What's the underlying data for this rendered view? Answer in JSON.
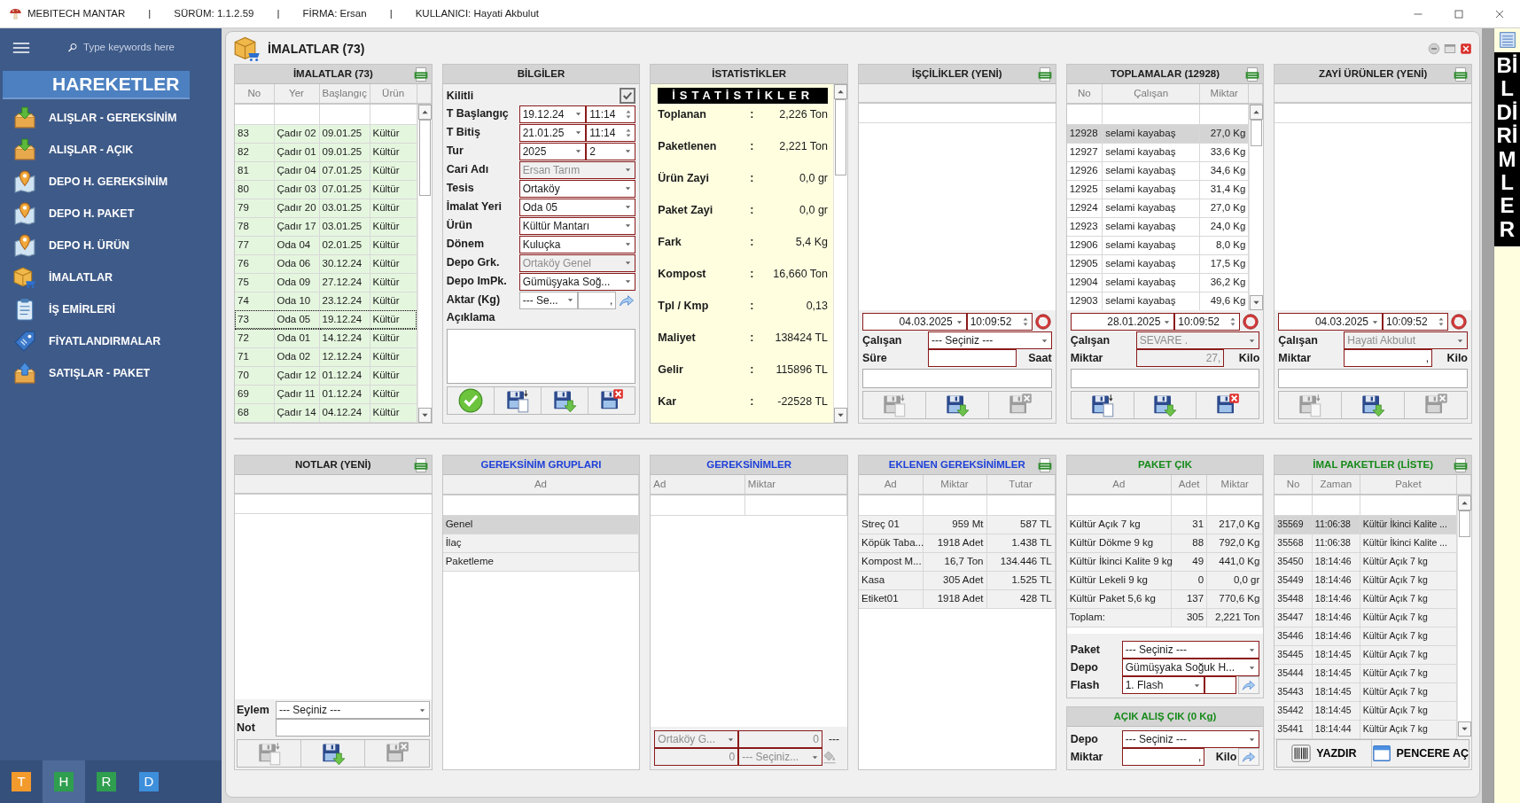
{
  "title_bar": {
    "app_name": "MEBITECH MANTAR",
    "fields": [
      {
        "sep": "|",
        "text": "SÜRÜM: 1.1.2.59"
      },
      {
        "sep": "|",
        "text": "FİRMA: Ersan"
      },
      {
        "sep": "|",
        "text": "KULLANICI: Hayati Akbulut"
      }
    ]
  },
  "sidebar": {
    "search_placeholder": "Type keywords here",
    "heading": "HAREKETLER",
    "items": [
      {
        "label": "ALIŞLAR - GEREKSİNİM",
        "kind": "tray-down"
      },
      {
        "label": "ALIŞLAR - AÇIK",
        "kind": "tray-down"
      },
      {
        "label": "DEPO H. GEREKSİNİM",
        "kind": "pin"
      },
      {
        "label": "DEPO H. PAKET",
        "kind": "pin"
      },
      {
        "label": "DEPO H. ÜRÜN",
        "kind": "pin"
      },
      {
        "label": "İMALATLAR",
        "kind": "box"
      },
      {
        "label": "İŞ EMİRLERİ",
        "kind": "clipboard"
      },
      {
        "label": "FİYATLANDIRMALAR",
        "kind": "tag"
      },
      {
        "label": "SATIŞLAR - PAKET",
        "kind": "tray-up"
      }
    ],
    "tabs": [
      {
        "label": "T",
        "color": "#f39a2c",
        "selected": false
      },
      {
        "label": "H",
        "color": "#2f9e4f",
        "selected": true
      },
      {
        "label": "R",
        "color": "#2f9e4f",
        "selected": false
      },
      {
        "label": "D",
        "color": "#3d8fdb",
        "selected": false
      }
    ]
  },
  "page_title": "İMALATLAR (73)",
  "imalatlar": {
    "title": "İMALATLAR (73)",
    "columns": [
      "No",
      "Yer",
      "Başlangıç",
      "Ürün"
    ],
    "rows": [
      {
        "cells": [
          "83",
          "Çadır 02",
          "09.01.25",
          "Kültür"
        ],
        "selected": false
      },
      {
        "cells": [
          "82",
          "Çadır 01",
          "09.01.25",
          "Kültür"
        ],
        "selected": false
      },
      {
        "cells": [
          "81",
          "Çadır 04",
          "07.01.25",
          "Kültür"
        ],
        "selected": false
      },
      {
        "cells": [
          "80",
          "Çadır 03",
          "07.01.25",
          "Kültür"
        ],
        "selected": false
      },
      {
        "cells": [
          "79",
          "Çadır 20",
          "03.01.25",
          "Kültür"
        ],
        "selected": false
      },
      {
        "cells": [
          "78",
          "Çadır 17",
          "03.01.25",
          "Kültür"
        ],
        "selected": false
      },
      {
        "cells": [
          "77",
          "Oda 04",
          "02.01.25",
          "Kültür"
        ],
        "selected": false
      },
      {
        "cells": [
          "76",
          "Oda 06",
          "30.12.24",
          "Kültür"
        ],
        "selected": false
      },
      {
        "cells": [
          "75",
          "Oda 09",
          "27.12.24",
          "Kültür"
        ],
        "selected": false
      },
      {
        "cells": [
          "74",
          "Oda 10",
          "23.12.24",
          "Kültür"
        ],
        "selected": false
      },
      {
        "cells": [
          "73",
          "Oda 05",
          "19.12.24",
          "Kültür"
        ],
        "selected": true
      },
      {
        "cells": [
          "72",
          "Oda 01",
          "14.12.24",
          "Kültür"
        ],
        "selected": false
      },
      {
        "cells": [
          "71",
          "Oda 02",
          "12.12.24",
          "Kültür"
        ],
        "selected": false
      },
      {
        "cells": [
          "70",
          "Çadır 12",
          "01.12.24",
          "Kültür"
        ],
        "selected": false
      },
      {
        "cells": [
          "69",
          "Çadır 11",
          "01.12.24",
          "Kültür"
        ],
        "selected": false
      },
      {
        "cells": [
          "68",
          "Çadır 14",
          "04.12.24",
          "Kültür"
        ],
        "selected": false
      }
    ]
  },
  "bilgiler": {
    "title": "BİLGİLER",
    "locked_label": "Kilitli",
    "locked": true,
    "fields": [
      {
        "label": "T Başlangıç",
        "kind": "datetime",
        "value": "19.12.24",
        "time": "11:14",
        "disabled": false
      },
      {
        "label": "T Bitiş",
        "kind": "datetime",
        "value": "21.01.25",
        "time": "11:14",
        "disabled": false
      },
      {
        "label": "Tur",
        "kind": "pair",
        "value": "2025",
        "value2": "2",
        "disabled": false
      },
      {
        "label": "Cari Adı",
        "kind": "select",
        "value": "Ersan Tarım",
        "disabled": true
      },
      {
        "label": "Tesis",
        "kind": "select",
        "value": "Ortaköy",
        "disabled": false
      },
      {
        "label": "İmalat Yeri",
        "kind": "select",
        "value": "Oda 05",
        "disabled": false
      },
      {
        "label": "Ürün",
        "kind": "select",
        "value": "Kültür Mantarı",
        "disabled": false
      },
      {
        "label": "Dönem",
        "kind": "select",
        "value": "Kuluçka",
        "disabled": false
      },
      {
        "label": "Depo Grk.",
        "kind": "select",
        "value": "Ortaköy Genel",
        "disabled": true
      },
      {
        "label": "Depo ImPk.",
        "kind": "select",
        "value": "Gümüşyaka Soğ...",
        "disabled": false
      },
      {
        "label": "Aktar (Kg)",
        "kind": "transfer",
        "value": "--- Se...",
        "amount": ",",
        "disabled": false
      }
    ],
    "notes_label": "Açıklama",
    "buttons": [
      {
        "kind": "confirm",
        "disabled": false
      },
      {
        "kind": "save-copy",
        "disabled": false
      },
      {
        "kind": "save",
        "disabled": false
      },
      {
        "kind": "delete",
        "disabled": false
      }
    ]
  },
  "istatistikler": {
    "title": "İSTATİSTİKLER",
    "banner": "İSTATİSTİKLER",
    "rows": [
      {
        "label": "Toplanan",
        "sep": ":",
        "value": "2,226 Ton"
      },
      {
        "label": "Paketlenen",
        "sep": ":",
        "value": "2,221 Ton"
      },
      {
        "label": "Ürün Zayi",
        "sep": ":",
        "value": "0,0 gr"
      },
      {
        "label": "Paket Zayi",
        "sep": ":",
        "value": "0,0 gr"
      },
      {
        "label": "Fark",
        "sep": ":",
        "value": "5,4 Kg"
      },
      {
        "label": "Kompost",
        "sep": ":",
        "value": "16,660 Ton"
      },
      {
        "label": "Tpl / Kmp",
        "sep": ":",
        "value": "0,13"
      },
      {
        "label": "Maliyet",
        "sep": ":",
        "value": "138424 TL"
      },
      {
        "label": "Gelir",
        "sep": ":",
        "value": "115896 TL"
      },
      {
        "label": "Kar",
        "sep": ":",
        "value": "-22528 TL"
      }
    ]
  },
  "iscilikler": {
    "title": "İŞÇİLİKLER (YENİ)",
    "form": {
      "date": "04.03.2025",
      "time": "10:09:52",
      "worker_label": "Çalışan",
      "worker": "--- Seçiniz ---",
      "worker_disabled": false,
      "amount_label": "Süre",
      "amount_disabled": false,
      "unit": "Saat"
    },
    "buttons": [
      {
        "kind": "save-copy",
        "disabled": true
      },
      {
        "kind": "save",
        "disabled": false
      },
      {
        "kind": "delete",
        "disabled": true
      }
    ]
  },
  "toplamalar": {
    "title": "TOPLAMALAR (12928)",
    "columns": [
      "No",
      "Çalışan",
      "Miktar"
    ],
    "rows": [
      {
        "cells": [
          "12928",
          "selami kayabaş",
          "27,0 Kg"
        ],
        "selected": true
      },
      {
        "cells": [
          "12927",
          "selami kayabaş",
          "33,6 Kg"
        ],
        "selected": false
      },
      {
        "cells": [
          "12926",
          "selami kayabaş",
          "34,6 Kg"
        ],
        "selected": false
      },
      {
        "cells": [
          "12925",
          "selami kayabaş",
          "31,4 Kg"
        ],
        "selected": false
      },
      {
        "cells": [
          "12924",
          "selami kayabaş",
          "27,0 Kg"
        ],
        "selected": false
      },
      {
        "cells": [
          "12923",
          "selami kayabaş",
          "24,0 Kg"
        ],
        "selected": false
      },
      {
        "cells": [
          "12906",
          "selami kayabaş",
          "8,0 Kg"
        ],
        "selected": false
      },
      {
        "cells": [
          "12905",
          "selami kayabaş",
          "17,5 Kg"
        ],
        "selected": false
      },
      {
        "cells": [
          "12904",
          "selami kayabaş",
          "36,2 Kg"
        ],
        "selected": false
      },
      {
        "cells": [
          "12903",
          "selami kayabaş",
          "49,6 Kg"
        ],
        "selected": false
      }
    ],
    "form": {
      "date": "28.01.2025",
      "time": "10:09:52",
      "worker_label": "Çalışan",
      "worker": "SEVARE .",
      "worker_disabled": true,
      "amount_label": "Miktar",
      "amount": "27,",
      "amount_disabled": true,
      "unit": "Kilo"
    },
    "buttons": [
      {
        "kind": "save-copy",
        "disabled": false
      },
      {
        "kind": "save",
        "disabled": false
      },
      {
        "kind": "delete",
        "disabled": false
      }
    ]
  },
  "zayi_urunler": {
    "title": "ZAYİ ÜRÜNLER (YENİ)",
    "form": {
      "date": "04.03.2025",
      "time": "10:09:52",
      "worker_label": "Çalışan",
      "worker": "Hayati Akbulut",
      "worker_disabled": true,
      "amount_label": "Miktar",
      "amount": ",",
      "amount_disabled": false,
      "unit": "Kilo"
    },
    "buttons": [
      {
        "kind": "save-copy",
        "disabled": true
      },
      {
        "kind": "save",
        "disabled": false
      },
      {
        "kind": "delete",
        "disabled": true
      }
    ]
  },
  "notlar": {
    "title": "NOTLAR (YENİ)",
    "action_label": "Eylem",
    "action": "--- Seçiniz ---",
    "note_label": "Not",
    "buttons": [
      {
        "kind": "save-copy",
        "disabled": true
      },
      {
        "kind": "save",
        "disabled": false
      },
      {
        "kind": "delete",
        "disabled": true
      }
    ]
  },
  "gereksinim_gruplari": {
    "title": "GEREKSİNİM GRUPLARI",
    "columns": [
      "Ad"
    ],
    "rows": [
      {
        "cells": [
          "Genel"
        ],
        "selected": true
      },
      {
        "cells": [
          "İlaç"
        ],
        "selected": false
      },
      {
        "cells": [
          "Paketleme"
        ],
        "selected": false
      }
    ]
  },
  "gereksinimler": {
    "title": "GEREKSİNİMLER",
    "columns": [
      "Ad",
      "Miktar"
    ],
    "footer": {
      "depot": "Ortaköy G...",
      "quantity": "0",
      "amount": "0",
      "select": "--- Seçiniz...",
      "dash": "---",
      "disabled": true
    }
  },
  "eklenen_gereksinimler": {
    "title": "EKLENEN GEREKSİNİMLER",
    "columns": [
      "Ad",
      "Miktar",
      "Tutar"
    ],
    "rows": [
      {
        "cells": [
          "Streç 01",
          "959 Mt",
          "587 TL"
        ]
      },
      {
        "cells": [
          "Köpük Taba...",
          "1918 Adet",
          "1.438 TL"
        ]
      },
      {
        "cells": [
          "Kompost M...",
          "16,7 Ton",
          "134.446 TL"
        ]
      },
      {
        "cells": [
          "Kasa",
          "305 Adet",
          "1.525 TL"
        ]
      },
      {
        "cells": [
          "Etiket01",
          "1918 Adet",
          "428 TL"
        ]
      }
    ]
  },
  "paket_cik": {
    "title": "PAKET ÇIK",
    "columns": [
      "Ad",
      "Adet",
      "Miktar"
    ],
    "rows": [
      {
        "cells": [
          "Kültür Açık 7 kg",
          "31",
          "217,0 Kg"
        ]
      },
      {
        "cells": [
          "Kültür Dökme 9 kg",
          "88",
          "792,0 Kg"
        ]
      },
      {
        "cells": [
          "Kültür İkinci Kalite 9 kg",
          "49",
          "441,0 Kg"
        ]
      },
      {
        "cells": [
          "Kültür Lekeli 9 kg",
          "0",
          "0,0 gr"
        ]
      },
      {
        "cells": [
          "Kültür Paket 5,6 kg",
          "137",
          "770,6 Kg"
        ]
      },
      {
        "cells": [
          "Toplam:",
          "305",
          "2,221 Ton"
        ]
      }
    ],
    "fields": [
      {
        "label": "Paket",
        "kind": "select",
        "value": "--- Seçiniz ---"
      },
      {
        "label": "Depo",
        "kind": "select",
        "value": "Gümüşyaka Soğuk H..."
      },
      {
        "label": "Flash",
        "kind": "flash",
        "value": "1. Flash"
      }
    ]
  },
  "acik_alis_cik": {
    "title": "AÇIK ALIŞ ÇIK (0 Kg)",
    "depot_label": "Depo",
    "depot": "--- Seçiniz ---",
    "amount_label": "Miktar",
    "amount": ",",
    "unit": "Kilo"
  },
  "imal_paketler": {
    "title": "İMAL PAKETLER (LİSTE)",
    "columns": [
      "No",
      "Zaman",
      "Paket"
    ],
    "rows": [
      {
        "cells": [
          "35569",
          "11:06:38",
          "Kültür İkinci Kalite ..."
        ],
        "selected": true
      },
      {
        "cells": [
          "35568",
          "11:06:38",
          "Kültür İkinci Kalite ..."
        ],
        "selected": false
      },
      {
        "cells": [
          "35450",
          "18:14:46",
          "Kültür Açık 7 kg"
        ],
        "selected": false
      },
      {
        "cells": [
          "35449",
          "18:14:46",
          "Kültür Açık 7 kg"
        ],
        "selected": false
      },
      {
        "cells": [
          "35448",
          "18:14:46",
          "Kültür Açık 7 kg"
        ],
        "selected": false
      },
      {
        "cells": [
          "35447",
          "18:14:46",
          "Kültür Açık 7 kg"
        ],
        "selected": false
      },
      {
        "cells": [
          "35446",
          "18:14:46",
          "Kültür Açık 7 kg"
        ],
        "selected": false
      },
      {
        "cells": [
          "35445",
          "18:14:45",
          "Kültür Açık 7 kg"
        ],
        "selected": false
      },
      {
        "cells": [
          "35444",
          "18:14:45",
          "Kültür Açık 7 kg"
        ],
        "selected": false
      },
      {
        "cells": [
          "35443",
          "18:14:45",
          "Kültür Açık 7 kg"
        ],
        "selected": false
      },
      {
        "cells": [
          "35442",
          "18:14:45",
          "Kültür Açık 7 kg"
        ],
        "selected": false
      },
      {
        "cells": [
          "35441",
          "18:14:44",
          "Kültür Açık 7 kg"
        ],
        "selected": false
      }
    ],
    "buttons": [
      {
        "label": "YAZDIR",
        "kind": "barcode"
      },
      {
        "label": "PENCERE AÇ",
        "kind": "window"
      }
    ]
  },
  "notifications": {
    "label": "BİLDİRİMLER"
  }
}
